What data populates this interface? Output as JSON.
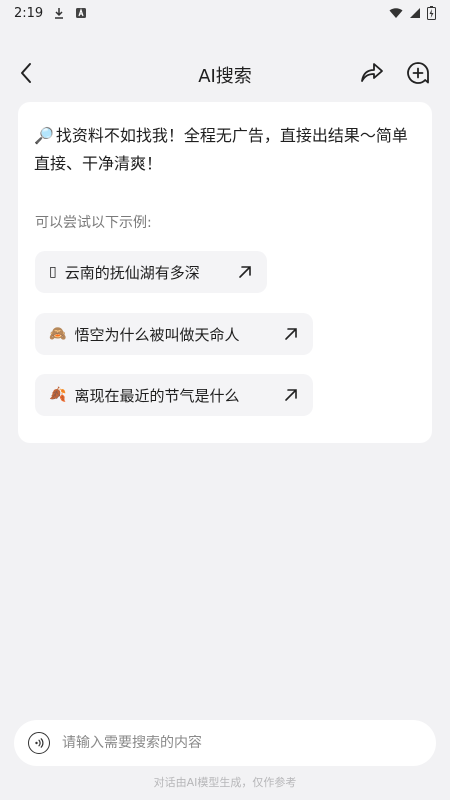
{
  "status_bar": {
    "time": "2:19",
    "icons": [
      "download-icon",
      "app-notification-icon",
      "wifi-icon",
      "signal-icon",
      "battery-charging-icon"
    ]
  },
  "header": {
    "title": "AI搜索",
    "back_icon": "chevron-left-icon",
    "share_icon": "share-arrow-icon",
    "new_chat_icon": "chat-plus-icon"
  },
  "card": {
    "intro_emoji": "🔎",
    "intro_text": "找资料不如找我！全程无广告，直接出结果～简单直接、干净清爽！",
    "examples_label": "可以尝试以下示例:",
    "examples": [
      {
        "emoji": "▯",
        "text": "云南的抚仙湖有多深"
      },
      {
        "emoji": "🙈",
        "text": "悟空为什么被叫做天命人"
      },
      {
        "emoji": "🍂",
        "text": "离现在最近的节气是什么"
      }
    ]
  },
  "input": {
    "placeholder": "请输入需要搜索的内容",
    "voice_icon": "voice-wave-icon"
  },
  "disclaimer": "对话由AI模型生成，仅作参考"
}
